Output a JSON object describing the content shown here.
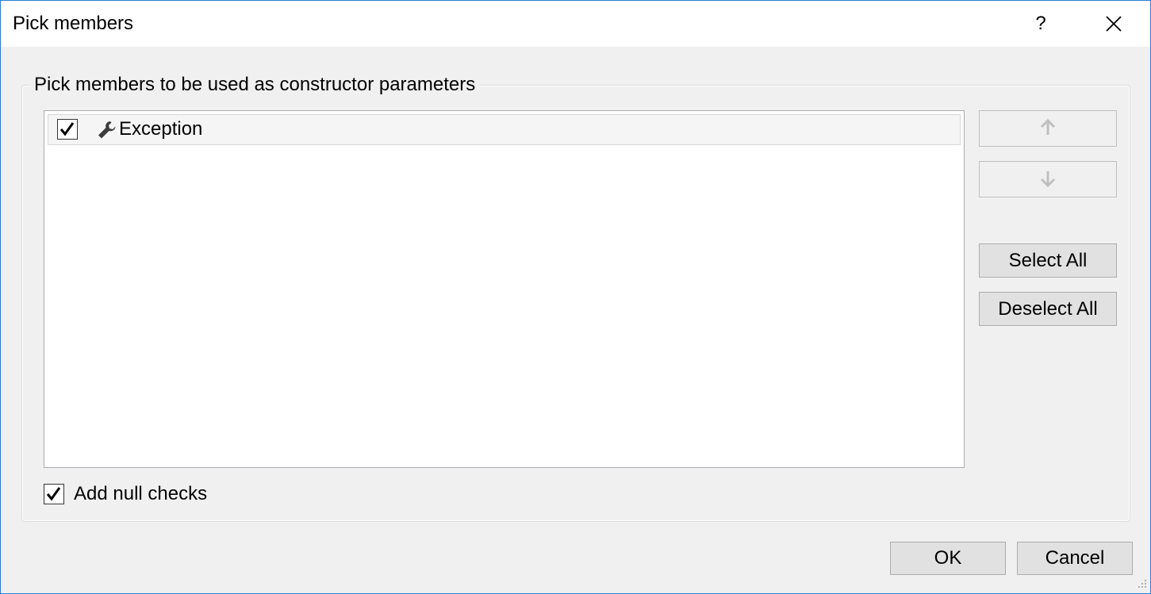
{
  "window": {
    "title": "Pick members",
    "help_label": "?",
    "border_color": "#2b7cd3",
    "background_color": "#f0f0f0"
  },
  "group": {
    "legend": "Pick members to be used as constructor parameters"
  },
  "members": [
    {
      "label": "Exception",
      "checked": true,
      "icon": "wrench-icon"
    }
  ],
  "side_buttons": {
    "move_up_icon": "arrow-up-icon",
    "move_up_disabled": true,
    "move_down_icon": "arrow-down-icon",
    "move_down_disabled": true,
    "select_all_label": "Select All",
    "deselect_all_label": "Deselect All"
  },
  "null_checks": {
    "label": "Add null checks",
    "checked": true
  },
  "footer": {
    "ok_label": "OK",
    "cancel_label": "Cancel"
  }
}
